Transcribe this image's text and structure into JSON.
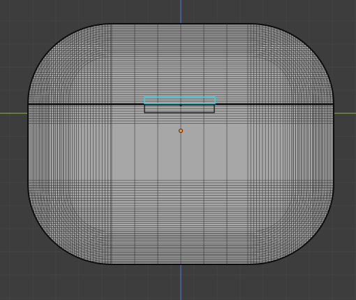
{
  "viewport": {
    "colors": {
      "background": "#3d3d3d",
      "grid_minor": "#444444",
      "grid_major": "#4a4a4a",
      "axis_x": "#7fa33a",
      "axis_y": "#4a72c4",
      "mesh_fill": "#a7a7a7",
      "mesh_fill_shaded": "#9c9c9c",
      "wire": "#1c1c1c",
      "outline": "#0d0d0d",
      "selection": "#37d3e6",
      "origin": "#ff8c1a"
    },
    "objects": {
      "case_mesh": {
        "name": "airpods-case-lid-and-body",
        "shading": "wireframe-overlay"
      },
      "selected_edges": "lid-hinge-slot",
      "object_origin": "origin-point"
    }
  }
}
